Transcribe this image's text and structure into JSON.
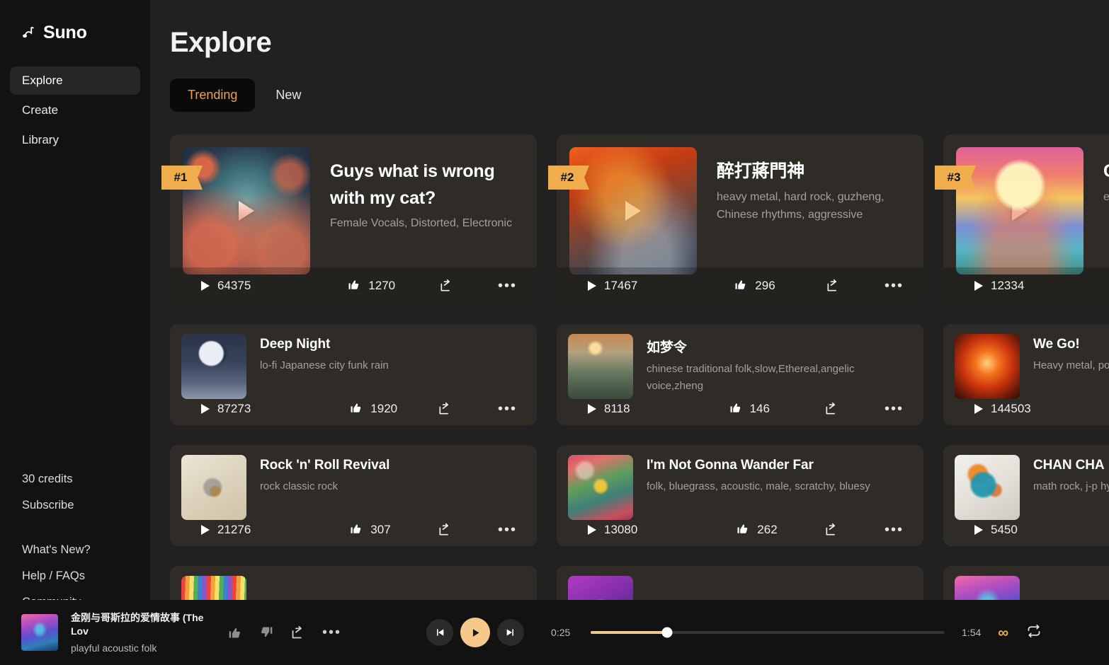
{
  "sidebar": {
    "brand": "Suno",
    "brand_icon": "suno-logo-icon",
    "nav": [
      {
        "label": "Explore",
        "active": true
      },
      {
        "label": "Create",
        "active": false
      },
      {
        "label": "Library",
        "active": false
      }
    ],
    "credits": "30 credits",
    "subscribe": "Subscribe",
    "links": [
      {
        "label": "What's New?"
      },
      {
        "label": "Help / FAQs"
      },
      {
        "label": "Community"
      }
    ],
    "avatar_icon": "user-avatar-icon"
  },
  "header": {
    "title": "Explore",
    "tabs": [
      {
        "label": "Trending",
        "active": true
      },
      {
        "label": "New",
        "active": false
      }
    ]
  },
  "featured": [
    {
      "rank": "#1",
      "title": "Guys what is wrong with my cat?",
      "tags": "Female Vocals, Distorted, Electronic",
      "plays": "64375",
      "likes": "1270",
      "art": "art-cat"
    },
    {
      "rank": "#2",
      "title": "醉打蔣門神",
      "tags": "heavy metal, hard rock, guzheng, Chinese rhythms, aggressive",
      "plays": "17467",
      "likes": "296",
      "art": "art-dragon"
    },
    {
      "rank": "#3",
      "title": "C",
      "tags": "e",
      "plays": "12334",
      "likes": "",
      "art": "art-capy"
    }
  ],
  "rows": [
    [
      {
        "title": "Deep Night",
        "tags": "lo-fi Japanese city funk rain",
        "plays": "87273",
        "likes": "1920",
        "art": "art-moon"
      },
      {
        "title": "如梦令",
        "tags": "chinese traditional folk,slow,Ethereal,angelic voice,zheng",
        "plays": "8118",
        "likes": "146",
        "art": "art-lotus"
      },
      {
        "title": "We Go!",
        "tags": "Heavy metal, powerful, agg",
        "plays": "144503",
        "likes": "",
        "art": "art-phoenix"
      }
    ],
    [
      {
        "title": "Rock 'n' Roll Revival",
        "tags": "rock classic rock",
        "plays": "21276",
        "likes": "307",
        "art": "art-bird1"
      },
      {
        "title": "I'm Not Gonna Wander Far",
        "tags": "folk, bluegrass, acoustic, male, scratchy, bluesy",
        "plays": "13080",
        "likes": "262",
        "art": "art-flowers"
      },
      {
        "title": "CHAN CHA",
        "tags": "math rock, j-p hyperspeed d",
        "plays": "5450",
        "likes": "",
        "art": "art-bird2"
      }
    ]
  ],
  "partial_row": [
    {
      "art": "art-stripe"
    },
    {
      "art": "art-purple"
    },
    {
      "art": "art-horse"
    }
  ],
  "player": {
    "track_title": "金刚与哥斯拉的爱情故事 (The Lov",
    "track_tags": "playful acoustic folk",
    "art": "art-horse",
    "like_icon": "thumbs-up-icon",
    "dislike_icon": "thumbs-down-icon",
    "share_icon": "share-icon",
    "more_icon": "more-options-icon",
    "prev_icon": "skip-previous-icon",
    "play_icon": "play-icon",
    "next_icon": "skip-next-icon",
    "current_time": "0:25",
    "total_time": "1:54",
    "progress_percent": "21.6",
    "infinity_icon": "infinity-icon",
    "repeat_icon": "repeat-one-icon"
  },
  "icons": {
    "play": "play-icon",
    "like": "thumbs-up-icon",
    "share": "share-icon",
    "more": "•••"
  },
  "colors": {
    "accent_orange": "#f0ad4e",
    "tab_active_text": "#f0a14b",
    "card_bg": "#2f2c28",
    "main_bg": "#212121",
    "sidebar_bg": "#121212",
    "player_accent": "#f6c88a"
  }
}
